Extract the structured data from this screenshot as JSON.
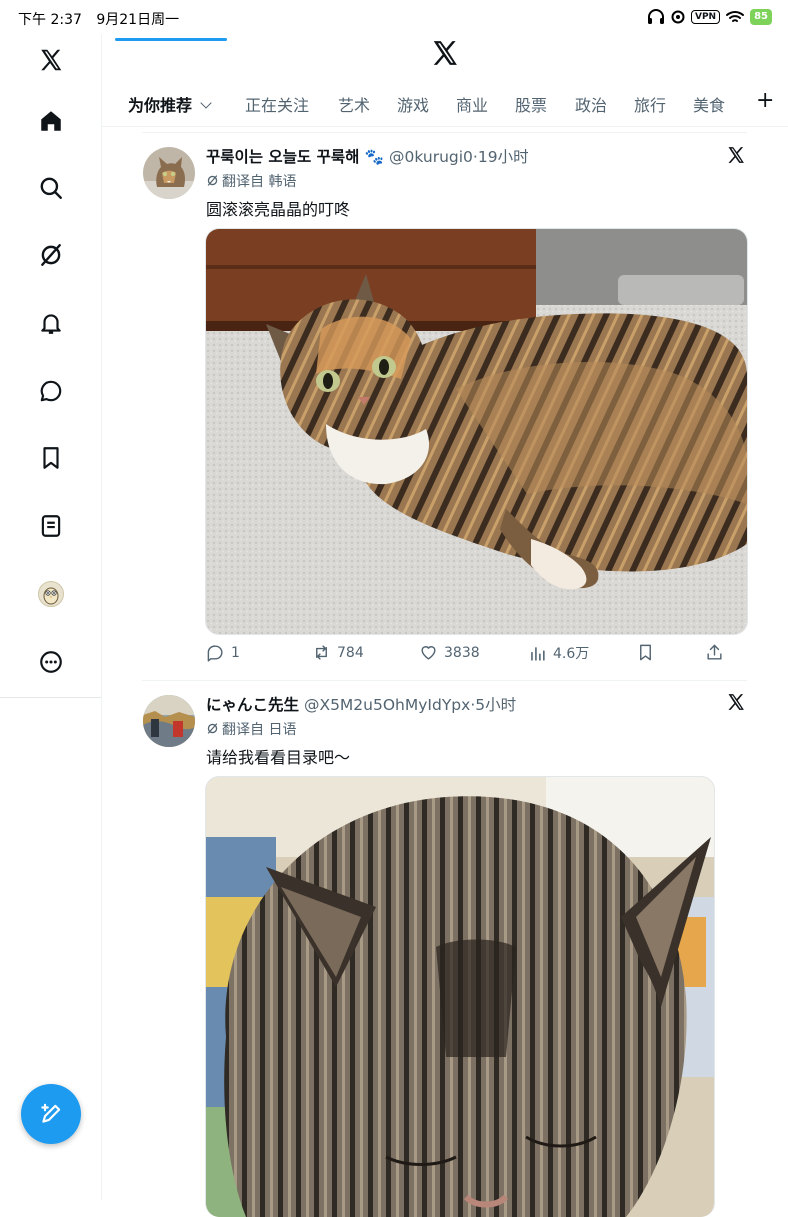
{
  "status_bar": {
    "time": "下午 2:37",
    "date": "9月21日周一",
    "vpn": "VPN",
    "battery": "85"
  },
  "sidebar": {
    "items": [
      {
        "icon": "x-logo-icon"
      },
      {
        "icon": "home-icon"
      },
      {
        "icon": "search-icon"
      },
      {
        "icon": "grok-icon"
      },
      {
        "icon": "bell-icon"
      },
      {
        "icon": "message-icon"
      },
      {
        "icon": "bookmark-icon"
      },
      {
        "icon": "list-icon"
      },
      {
        "icon": "profile-avatar"
      },
      {
        "icon": "more-icon"
      }
    ]
  },
  "header": {
    "tabs": [
      {
        "label": "为你推荐",
        "active": true
      },
      {
        "label": "正在关注"
      },
      {
        "label": "艺术"
      },
      {
        "label": "游戏"
      },
      {
        "label": "商业"
      },
      {
        "label": "股票"
      },
      {
        "label": "政治"
      },
      {
        "label": "旅行"
      },
      {
        "label": "美食"
      }
    ],
    "add_tab": "+"
  },
  "posts": [
    {
      "name": "꾸룩이는 오늘도 꾸룩해 🐾",
      "handle": "@0kurugi0",
      "time": "19小时",
      "translated": "翻译自 韩语",
      "text": "圆滚滚亮晶晶的叮咚",
      "stats": {
        "replies": "1",
        "reposts": "784",
        "likes": "3838",
        "views": "4.6万"
      }
    },
    {
      "name": "にゃんこ先生",
      "handle": "@X5M2u5OhMyIdYpx",
      "time": "5小时",
      "translated": "翻译自 日语",
      "text": "请给我看看目录吧～"
    }
  ],
  "colors": {
    "accent": "#1d9bf0",
    "text": "#0f1419",
    "muted": "#536471"
  }
}
